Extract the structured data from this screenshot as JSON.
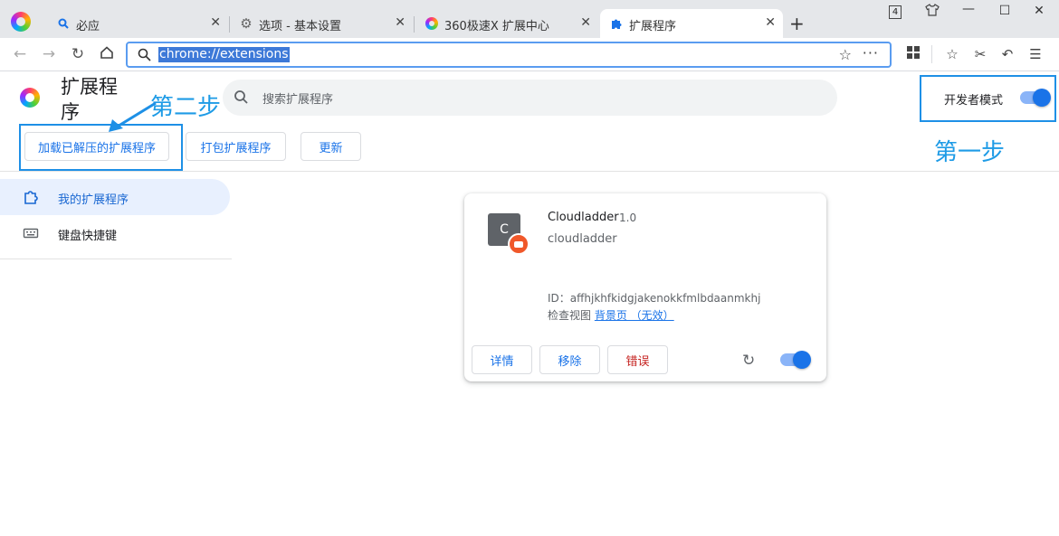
{
  "tabs": [
    {
      "label": "必应",
      "icon": "search-icon"
    },
    {
      "label": "选项 - 基本设置",
      "icon": "gear-icon"
    },
    {
      "label": "360极速X 扩展中心",
      "icon": "browser-logo-icon"
    },
    {
      "label": "扩展程序",
      "icon": "puzzle-icon",
      "active": true
    }
  ],
  "tab_count": "4",
  "address_bar": {
    "url": "chrome://extensions"
  },
  "page": {
    "title": "扩展程序",
    "search_placeholder": "搜索扩展程序",
    "developer_mode_label": "开发者模式",
    "developer_mode_on": true
  },
  "actions": {
    "load_unpacked": "加载已解压的扩展程序",
    "pack": "打包扩展程序",
    "update": "更新"
  },
  "annotations": {
    "step1": "第一步",
    "step2": "第二步"
  },
  "sidebar": {
    "items": [
      {
        "label": "我的扩展程序",
        "icon": "puzzle-icon",
        "active": true
      },
      {
        "label": "键盘快捷键",
        "icon": "keyboard-icon"
      }
    ]
  },
  "extension": {
    "avatar_letter": "C",
    "name": "Cloudladder",
    "version": "1.0",
    "description": "cloudladder",
    "id_text": "ID：affhjkhfkidgjakenokkfmlbdaanmkhj",
    "inspect_label": "检查视图",
    "inspect_link": "背景页 （无效）",
    "enabled": true,
    "buttons": {
      "details": "详情",
      "remove": "移除",
      "errors": "错误"
    }
  },
  "colors": {
    "accent": "#1a73e8",
    "annotation": "#1e9be6",
    "error": "#c5221f"
  }
}
